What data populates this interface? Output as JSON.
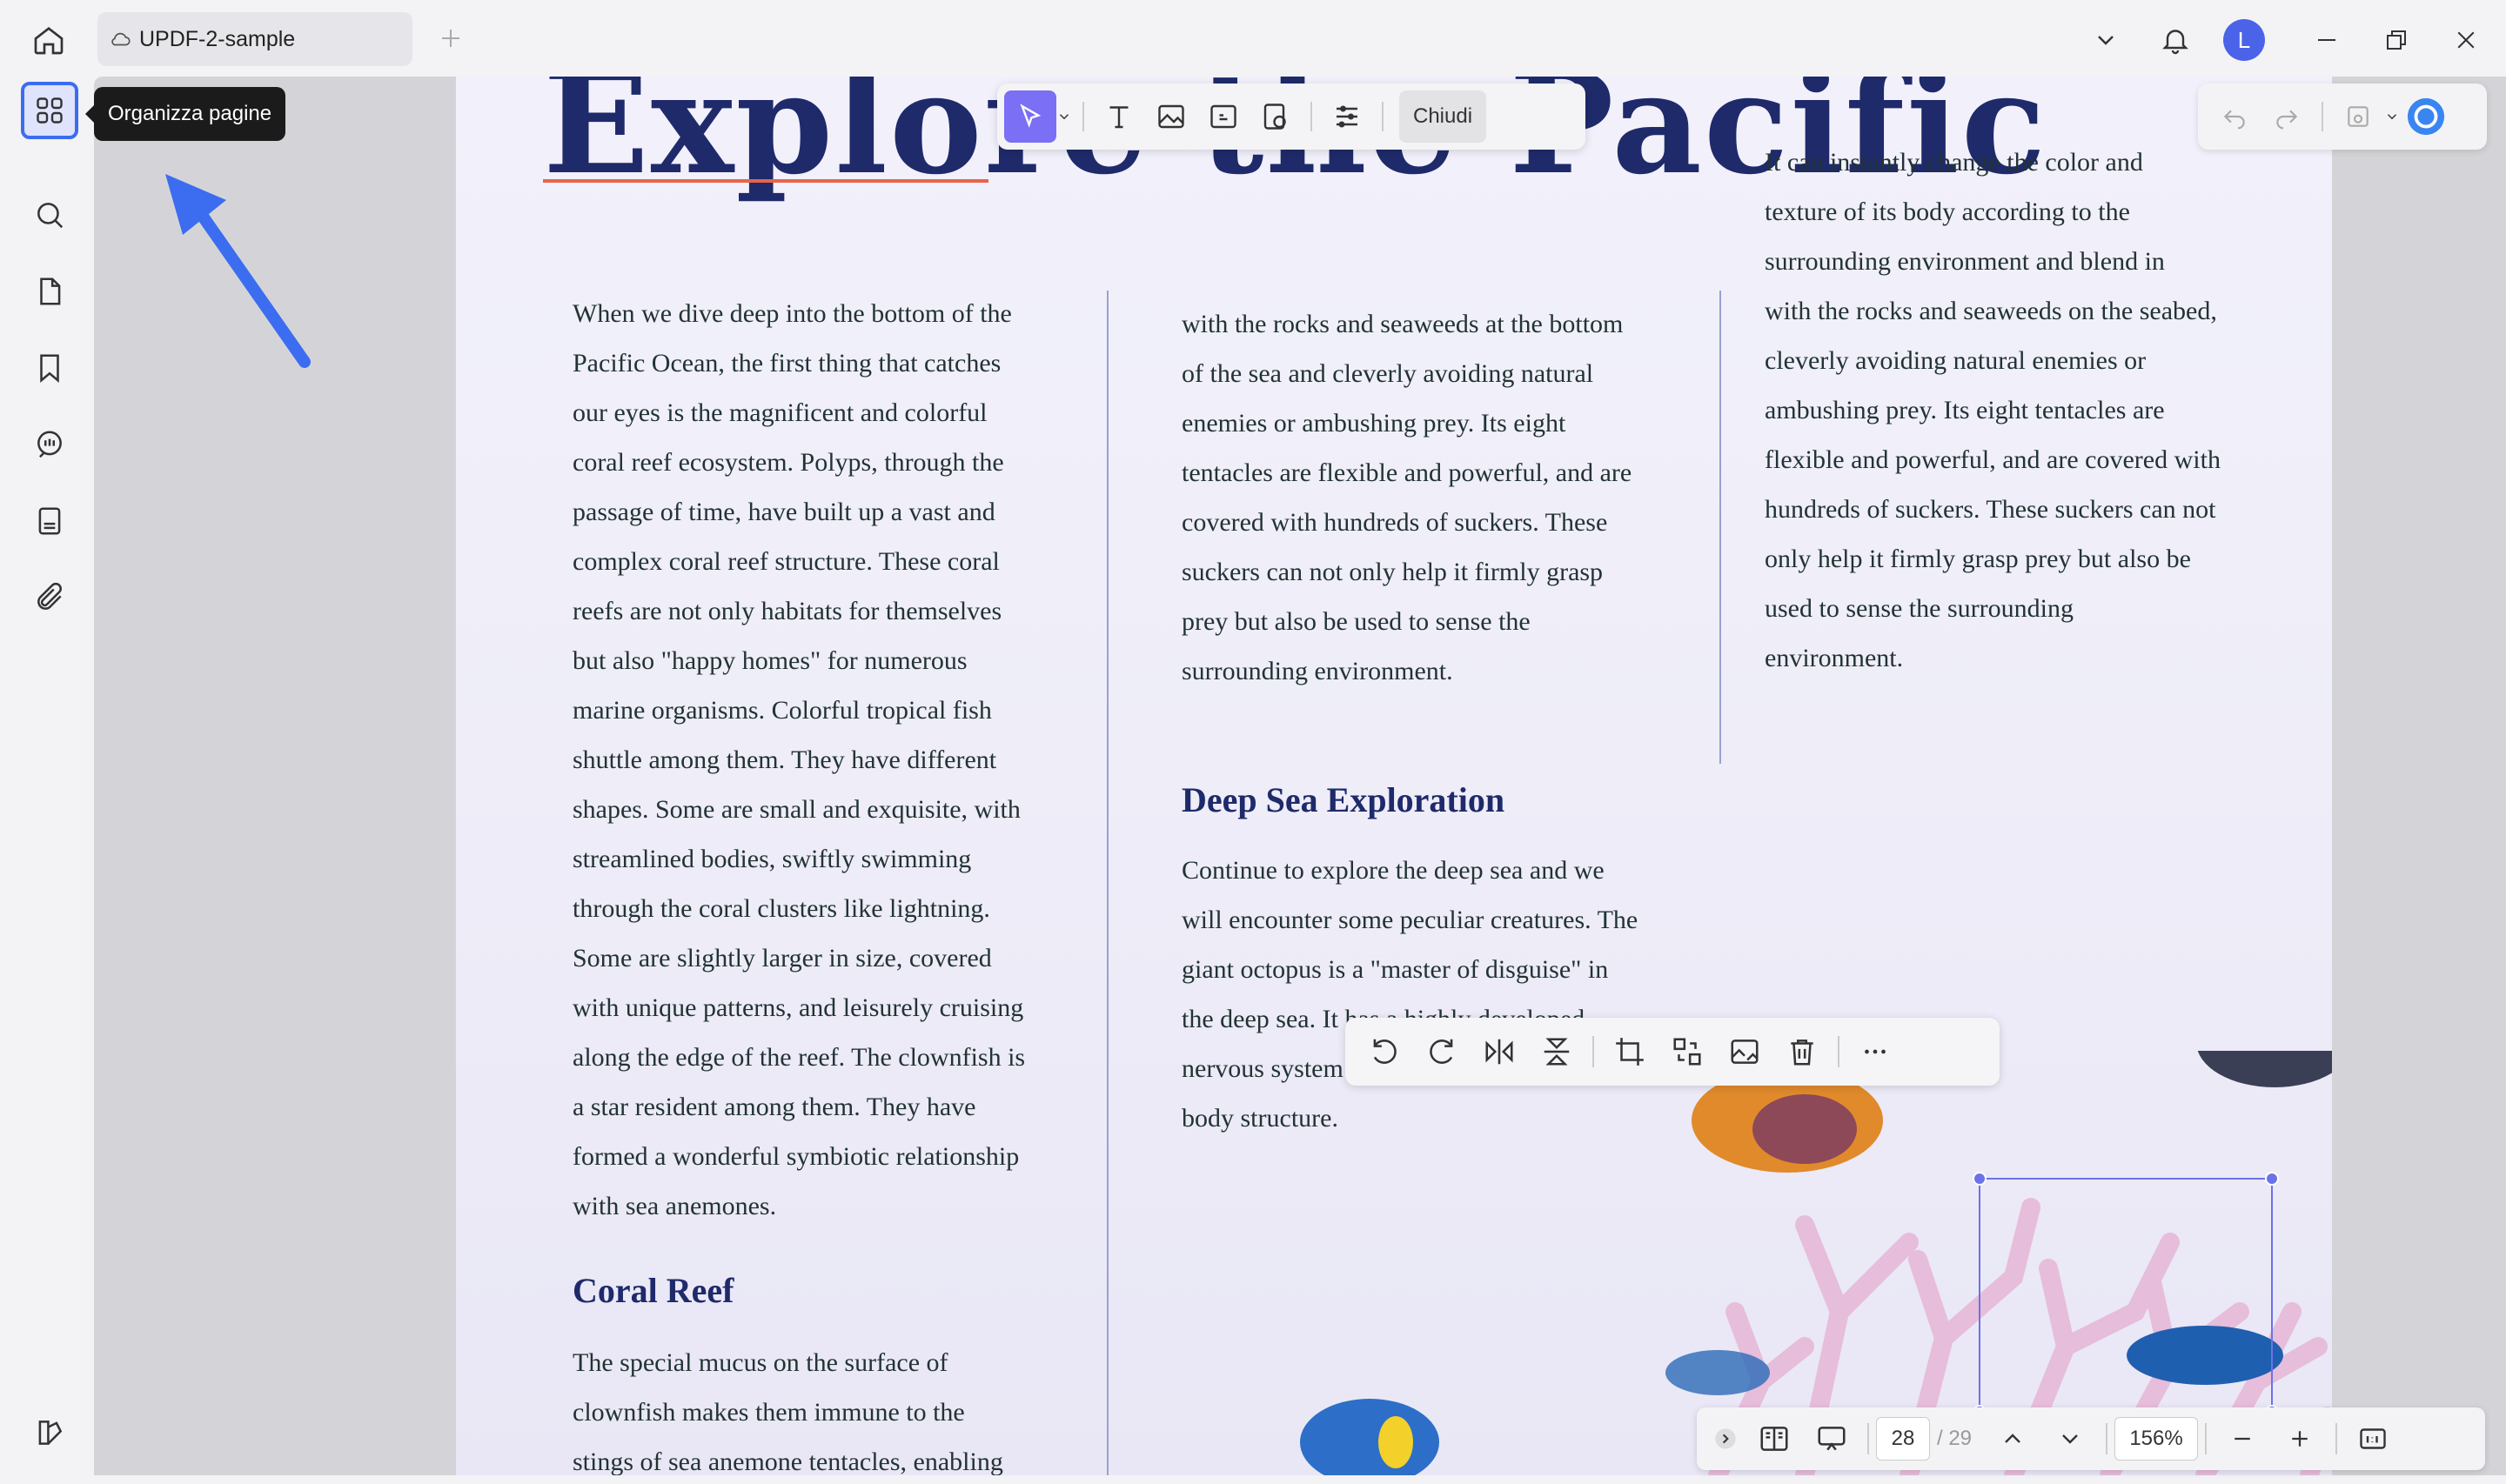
{
  "tab": {
    "title": "UPDF-2-sample"
  },
  "tooltip": {
    "text": "Organizza pagine"
  },
  "avatar": {
    "initial": "L"
  },
  "toolbar": {
    "close_label": "Chiudi"
  },
  "document": {
    "title": "Explore the Pacific",
    "col1": "When we dive deep into the bottom of the\nPacific Ocean, the first thing that catches\nour eyes is the magnificent and colorful\ncoral reef ecosystem. Polyps, through the\npassage of time, have built up a vast and\ncomplex coral reef structure. These coral\nreefs are not only habitats for themselves\nbut also \"happy homes\" for numerous\nmarine organisms. Colorful tropical fish\nshuttle among them. They have different\nshapes. Some are small and exquisite, with\nstreamlined bodies, swiftly swimming\nthrough the coral clusters like lightning.\nSome are slightly larger in size, covered\nwith unique patterns, and leisurely cruising\nalong the edge of the reef. The clownfish is\na star resident among them. They have\nformed a wonderful symbiotic relationship\nwith sea anemones.",
    "heading_coral": "Coral Reef",
    "coral_text": " The special mucus on the surface of\nclownfish makes them immune to the\nstings of sea anemone tentacles, enabling",
    "col2": "with the rocks and seaweeds at the bottom\nof the sea and cleverly avoiding natural\nenemies or ambushing prey. Its eight\ntentacles are flexible and powerful, and are\ncovered with hundreds of suckers. These\nsuckers can not only help it firmly grasp\nprey but also be used to sense the\nsurrounding environment.",
    "heading_deep": "Deep Sea Exploration",
    "deep_text": "Continue to explore the deep sea and we\nwill encounter some peculiar creatures. The\ngiant octopus is a \"master of disguise\" in\nthe deep sea. It has a highly developed\nnervous system\nbody structure.",
    "col3": "It can instantly change the color and\ntexture of its body according to the\nsurrounding environment and blend in\nwith the rocks and seaweeds on the seabed,\ncleverly avoiding natural enemies or\nambushing prey. Its eight tentacles are\nflexible and powerful, and are covered with\nhundreds of suckers. These suckers can not\nonly help it firmly grasp prey but also be\nused to sense the surrounding\nenvironment."
  },
  "bottom": {
    "page": "28",
    "total": "/ 29",
    "zoom": "156%"
  },
  "colors": {
    "accent": "#3c6df0",
    "title": "#1f2a6b",
    "tool_selected": "#7b6ff5"
  }
}
